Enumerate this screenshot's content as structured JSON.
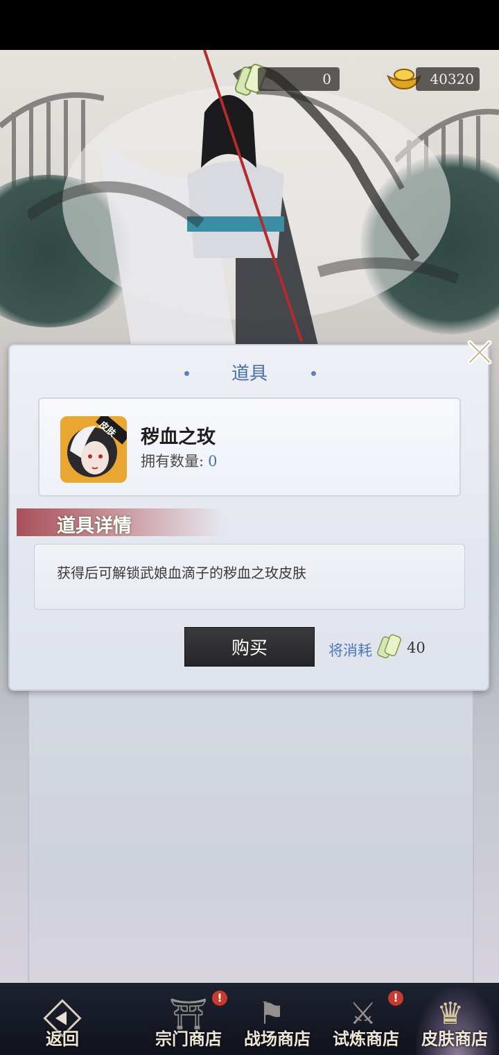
{
  "currency": {
    "token_amount": "0",
    "ingot_amount": "40320"
  },
  "dialog": {
    "title": "道具",
    "item": {
      "name": "秽血之玫",
      "owned_label": "拥有数量:",
      "owned_value": "0",
      "avatar_tag": "皮肤"
    },
    "details_title": "道具详情",
    "description": "获得后可解锁武娘血滴子的秽血之玫皮肤",
    "buy_label": "购买",
    "cost_label": "将消耗",
    "cost_value": "40"
  },
  "bottom_nav": {
    "back": "返回",
    "items": [
      {
        "label": "宗门商店",
        "badge": "!"
      },
      {
        "label": "战场商店",
        "badge": ""
      },
      {
        "label": "试炼商店",
        "badge": "!"
      },
      {
        "label": "皮肤商店",
        "badge": ""
      }
    ]
  },
  "colors": {
    "accent_blue": "#4a6fa8",
    "banner_red": "#a8505a",
    "button_dark": "#2e2e30",
    "badge_red": "#c63b2f"
  }
}
